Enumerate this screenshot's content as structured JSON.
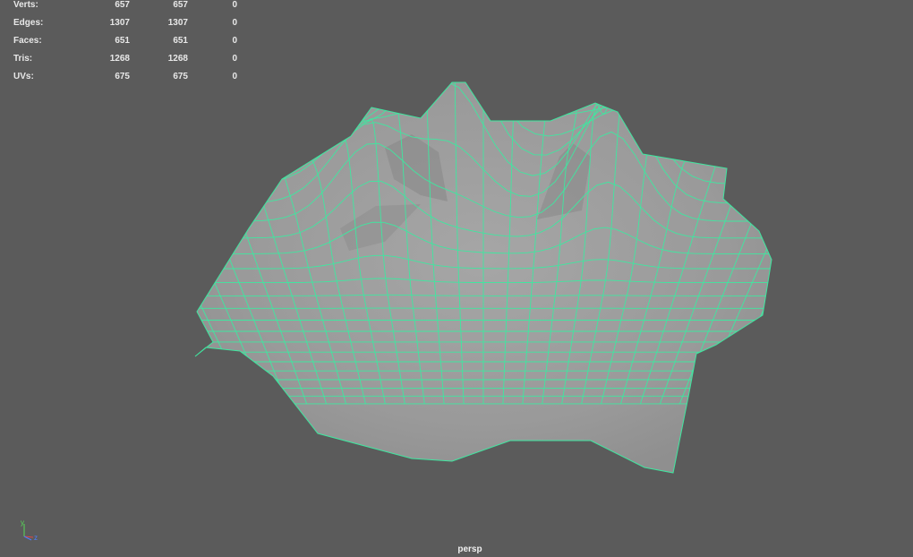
{
  "stats": {
    "rows": [
      {
        "label": "Verts:",
        "v1": "657",
        "v2": "657",
        "v3": "0"
      },
      {
        "label": "Edges:",
        "v1": "1307",
        "v2": "1307",
        "v3": "0"
      },
      {
        "label": "Faces:",
        "v1": "651",
        "v2": "651",
        "v3": "0"
      },
      {
        "label": "Tris:",
        "v1": "1268",
        "v2": "1268",
        "v3": "0"
      },
      {
        "label": "UVs:",
        "v1": "675",
        "v2": "675",
        "v3": "0"
      }
    ]
  },
  "viewport": {
    "camera": "persp",
    "background_color": "#5b5b5b",
    "mesh_fill_color": "#9c9c9c",
    "wire_color": "#3fe7a0"
  },
  "axis_gizmo": {
    "labels": [
      "y",
      "z"
    ],
    "y_color": "#57d957",
    "z_color": "#4d7dff",
    "x_color": "#e04545"
  }
}
